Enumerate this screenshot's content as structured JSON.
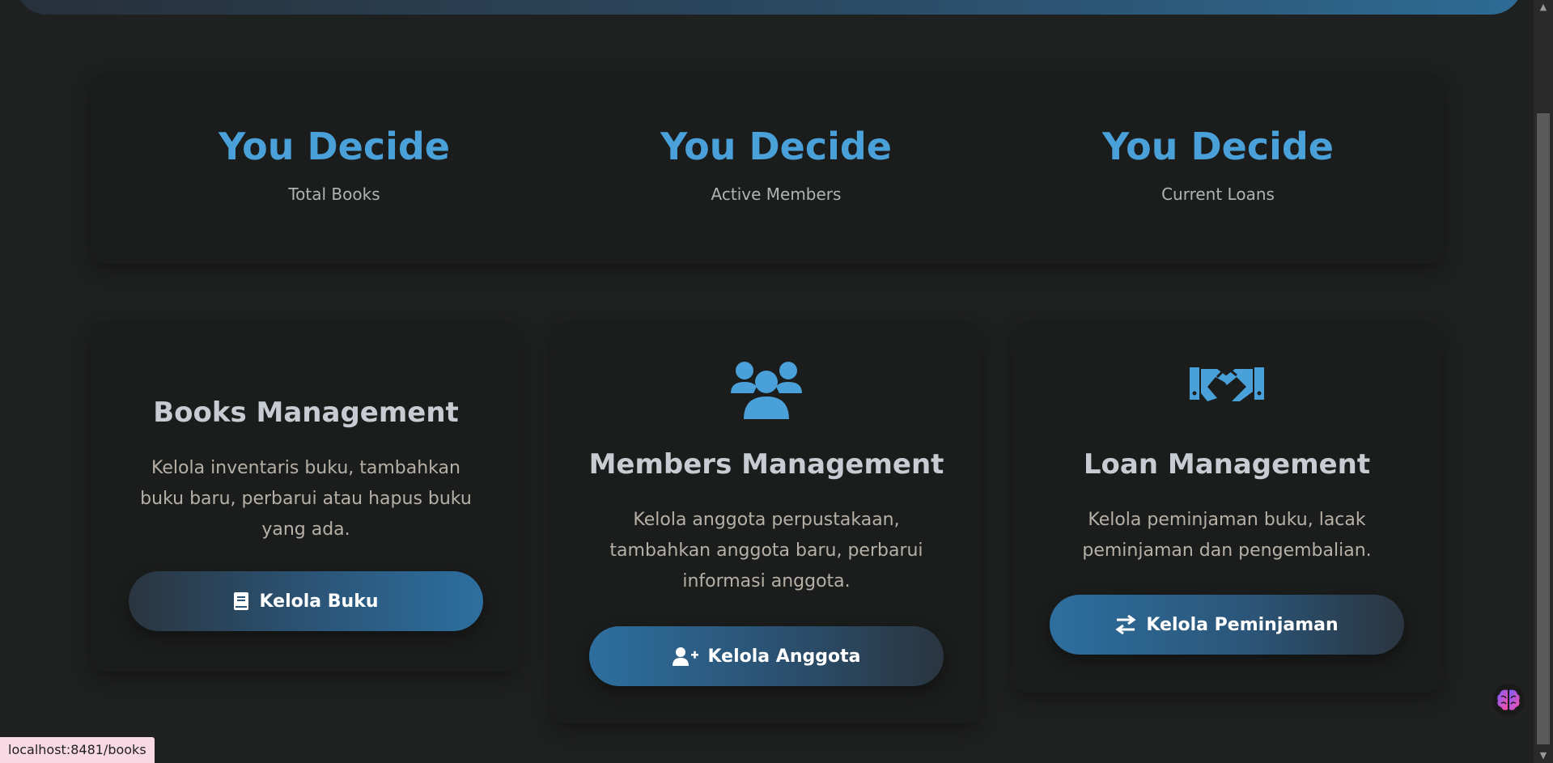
{
  "stats": [
    {
      "value": "You Decide",
      "label": "Total Books"
    },
    {
      "value": "You Decide",
      "label": "Active Members"
    },
    {
      "value": "You Decide",
      "label": "Current Loans"
    }
  ],
  "cards": {
    "books": {
      "title": "Books Management",
      "description": "Kelola inventaris buku, tambahkan buku baru, perbarui atau hapus buku yang ada.",
      "button_label": "Kelola Buku",
      "icon": "book-icon"
    },
    "members": {
      "title": "Members Management",
      "description": "Kelola anggota perpustakaan, tambahkan anggota baru, perbarui informasi anggota.",
      "button_label": "Kelola Anggota",
      "icon": "users-icon",
      "button_icon": "user-plus-icon"
    },
    "loans": {
      "title": "Loan Management",
      "description": "Kelola peminjaman buku, lacak peminjaman dan pengembalian.",
      "button_label": "Kelola Peminjaman",
      "icon": "handshake-icon",
      "button_icon": "exchange-arrows-icon"
    }
  },
  "status_bar": {
    "url": "localhost:8481/books"
  },
  "colors": {
    "accent": "#4aa0d8",
    "background": "#1f2020",
    "card": "#1b1c1c"
  }
}
